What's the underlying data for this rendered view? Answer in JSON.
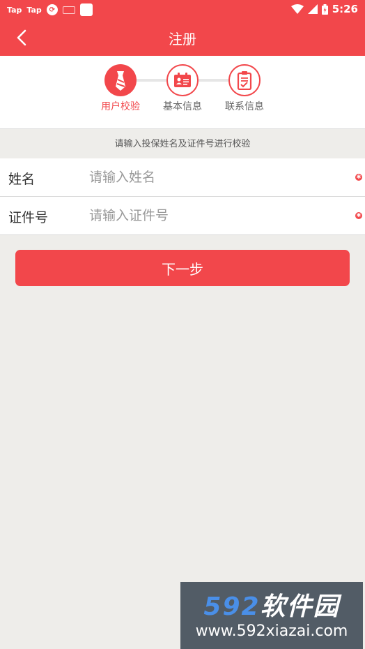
{
  "statusbar": {
    "app1": "Tap",
    "app2": "Tap",
    "time": "5:26"
  },
  "titlebar": {
    "title": "注册"
  },
  "steps": [
    {
      "label": "用户校验",
      "icon": "tie-icon",
      "active": true
    },
    {
      "label": "基本信息",
      "icon": "id-card-icon",
      "active": false
    },
    {
      "label": "联系信息",
      "icon": "clipboard-icon",
      "active": false
    }
  ],
  "hint": "请输入投保姓名及证件号进行校验",
  "form": {
    "name_label": "姓名",
    "name_placeholder": "请输入姓名",
    "name_value": "",
    "id_label": "证件号",
    "id_placeholder": "请输入证件号",
    "id_value": ""
  },
  "next_label": "下一步",
  "watermark": {
    "brand_num": "592",
    "brand_text": "软件园",
    "url": "www.592xiazai.com"
  },
  "colors": {
    "accent": "#f2474b",
    "background": "#eeedea"
  }
}
